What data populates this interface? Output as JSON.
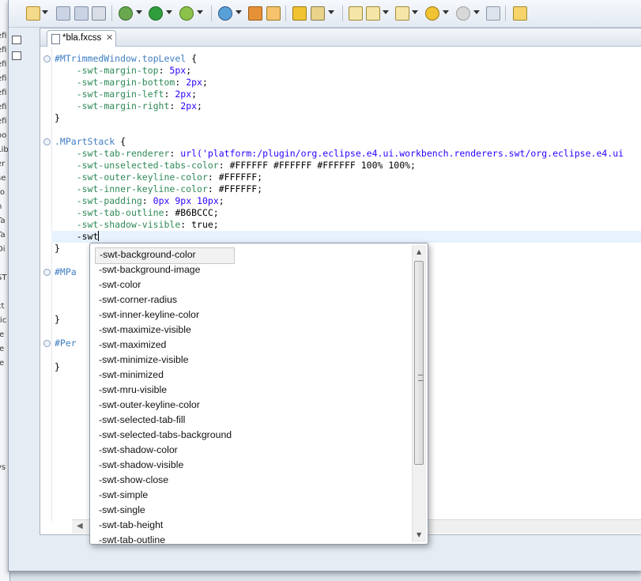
{
  "editor": {
    "tab": {
      "label": "*bla.fxcss",
      "close_glyph": "✕",
      "icon": "file-icon"
    },
    "code_lines": [
      {
        "fold": true,
        "parts": [
          [
            "sel",
            "#MTrimmedWindow.topLevel"
          ],
          [
            "plain",
            " {"
          ]
        ]
      },
      {
        "parts": [
          [
            "plain",
            "    "
          ],
          [
            "prop",
            "-swt-margin-top"
          ],
          [
            "plain",
            ": "
          ],
          [
            "num",
            "5px"
          ],
          [
            "plain",
            ";"
          ]
        ]
      },
      {
        "parts": [
          [
            "plain",
            "    "
          ],
          [
            "prop",
            "-swt-margin-bottom"
          ],
          [
            "plain",
            ": "
          ],
          [
            "num",
            "2px"
          ],
          [
            "plain",
            ";"
          ]
        ]
      },
      {
        "parts": [
          [
            "plain",
            "    "
          ],
          [
            "prop",
            "-swt-margin-left"
          ],
          [
            "plain",
            ": "
          ],
          [
            "num",
            "2px"
          ],
          [
            "plain",
            ";"
          ]
        ]
      },
      {
        "parts": [
          [
            "plain",
            "    "
          ],
          [
            "prop",
            "-swt-margin-right"
          ],
          [
            "plain",
            ": "
          ],
          [
            "num",
            "2px"
          ],
          [
            "plain",
            ";"
          ]
        ]
      },
      {
        "parts": [
          [
            "plain",
            "}"
          ]
        ]
      },
      {
        "parts": []
      },
      {
        "fold": true,
        "parts": [
          [
            "sel",
            ".MPartStack"
          ],
          [
            "plain",
            " {"
          ]
        ]
      },
      {
        "parts": [
          [
            "plain",
            "    "
          ],
          [
            "prop",
            "-swt-tab-renderer"
          ],
          [
            "plain",
            ": "
          ],
          [
            "val",
            "url('platform:/plugin/org.eclipse.e4.ui.workbench.renderers.swt/org.eclipse.e4.ui"
          ]
        ]
      },
      {
        "parts": [
          [
            "plain",
            "    "
          ],
          [
            "prop",
            "-swt-unselected-tabs-color"
          ],
          [
            "plain",
            ": #FFFFFF #FFFFFF #FFFFFF 100% 100%;"
          ]
        ]
      },
      {
        "parts": [
          [
            "plain",
            "    "
          ],
          [
            "prop",
            "-swt-outer-keyline-color"
          ],
          [
            "plain",
            ": #FFFFFF;"
          ]
        ]
      },
      {
        "parts": [
          [
            "plain",
            "    "
          ],
          [
            "prop",
            "-swt-inner-keyline-color"
          ],
          [
            "plain",
            ": #FFFFFF;"
          ]
        ]
      },
      {
        "parts": [
          [
            "plain",
            "    "
          ],
          [
            "prop",
            "-swt-padding"
          ],
          [
            "plain",
            ": "
          ],
          [
            "num",
            "0px 9px 10px"
          ],
          [
            "plain",
            ";"
          ]
        ]
      },
      {
        "parts": [
          [
            "plain",
            "    "
          ],
          [
            "prop",
            "-swt-tab-outline"
          ],
          [
            "plain",
            ": #B6BCCC;"
          ]
        ]
      },
      {
        "parts": [
          [
            "plain",
            "    "
          ],
          [
            "prop",
            "-swt-shadow-visible"
          ],
          [
            "plain",
            ": true;"
          ]
        ]
      },
      {
        "current": true,
        "parts": [
          [
            "plain",
            "    -swt"
          ]
        ]
      },
      {
        "parts": [
          [
            "plain",
            "}"
          ]
        ]
      },
      {
        "parts": []
      },
      {
        "fold": true,
        "parts": [
          [
            "sel",
            "#MPa"
          ]
        ]
      },
      {
        "parts": []
      },
      {
        "parts": []
      },
      {
        "parts": []
      },
      {
        "parts": [
          [
            "plain",
            "}"
          ]
        ]
      },
      {
        "parts": []
      },
      {
        "fold": true,
        "parts": [
          [
            "sel",
            "#Per"
          ]
        ]
      },
      {
        "parts": []
      },
      {
        "parts": [
          [
            "plain",
            "}"
          ]
        ]
      }
    ]
  },
  "autocomplete": {
    "items": [
      "-swt-background-color",
      "-swt-background-image",
      "-swt-color",
      "-swt-corner-radius",
      "-swt-inner-keyline-color",
      "-swt-maximize-visible",
      "-swt-maximized",
      "-swt-minimize-visible",
      "-swt-minimized",
      "-swt-mru-visible",
      "-swt-outer-keyline-color",
      "-swt-selected-tab-fill",
      "-swt-selected-tabs-background",
      "-swt-shadow-color",
      "-swt-shadow-visible",
      "-swt-show-close",
      "-swt-simple",
      "-swt-single",
      "-swt-tab-height",
      "-swt-tab-outline"
    ],
    "selected_index": 0
  },
  "background_window": {
    "fragments": [
      "efi",
      "efi",
      "efi",
      "efi",
      "efi",
      "efi",
      "efi",
      "oo",
      "Lib",
      "er",
      "se",
      "ro",
      "n",
      "Ta",
      "Ta",
      "Di",
      "ST",
      "ct",
      "tic",
      ".e",
      ".e",
      ".e",
      "vs"
    ]
  },
  "colors": {
    "selector": "#3f7ec2",
    "property": "#2e8a57",
    "value": "#2a00ff",
    "current_line": "#e8f2fe"
  }
}
